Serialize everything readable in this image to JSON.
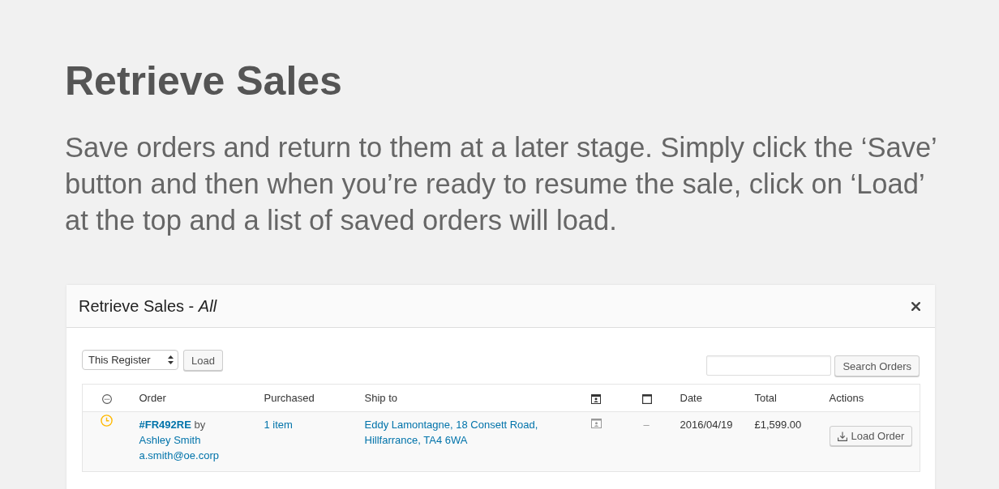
{
  "page": {
    "title": "Retrieve Sales",
    "description": "Save orders and return to them at a later stage. Simply click the ‘Save’ button and then when you’re ready to resume the sale, click on ‘Load’ at the top and a list of saved orders will load."
  },
  "modal": {
    "title": "Retrieve Sales - *All*",
    "toolbar": {
      "register_select": {
        "value": "This Register"
      },
      "load_button": "Load",
      "search_button": "Search Orders"
    },
    "table": {
      "columns": [
        {
          "kind": "status"
        },
        {
          "kind": "text",
          "label": "Order"
        },
        {
          "kind": "text",
          "label": "Purchased"
        },
        {
          "kind": "text",
          "label": "Ship to"
        },
        {
          "kind": "customer"
        },
        {
          "kind": "window"
        },
        {
          "kind": "text",
          "label": "Date"
        },
        {
          "kind": "text",
          "label": "Total"
        },
        {
          "kind": "text",
          "label": "Actions"
        }
      ],
      "rows": [
        {
          "order_number": "#FR492RE",
          "by": "by",
          "customer": "Ashley Smith",
          "email": "a.smith@oe.corp",
          "purchased": "1 item",
          "ship_to": "Eddy Lamontagne, 18 Consett Road, Hillfarrance, TA4 6WA",
          "column_6": "–",
          "date": "2016/04/19",
          "total": "£1,599.00",
          "action": "Load Order"
        }
      ]
    }
  }
}
